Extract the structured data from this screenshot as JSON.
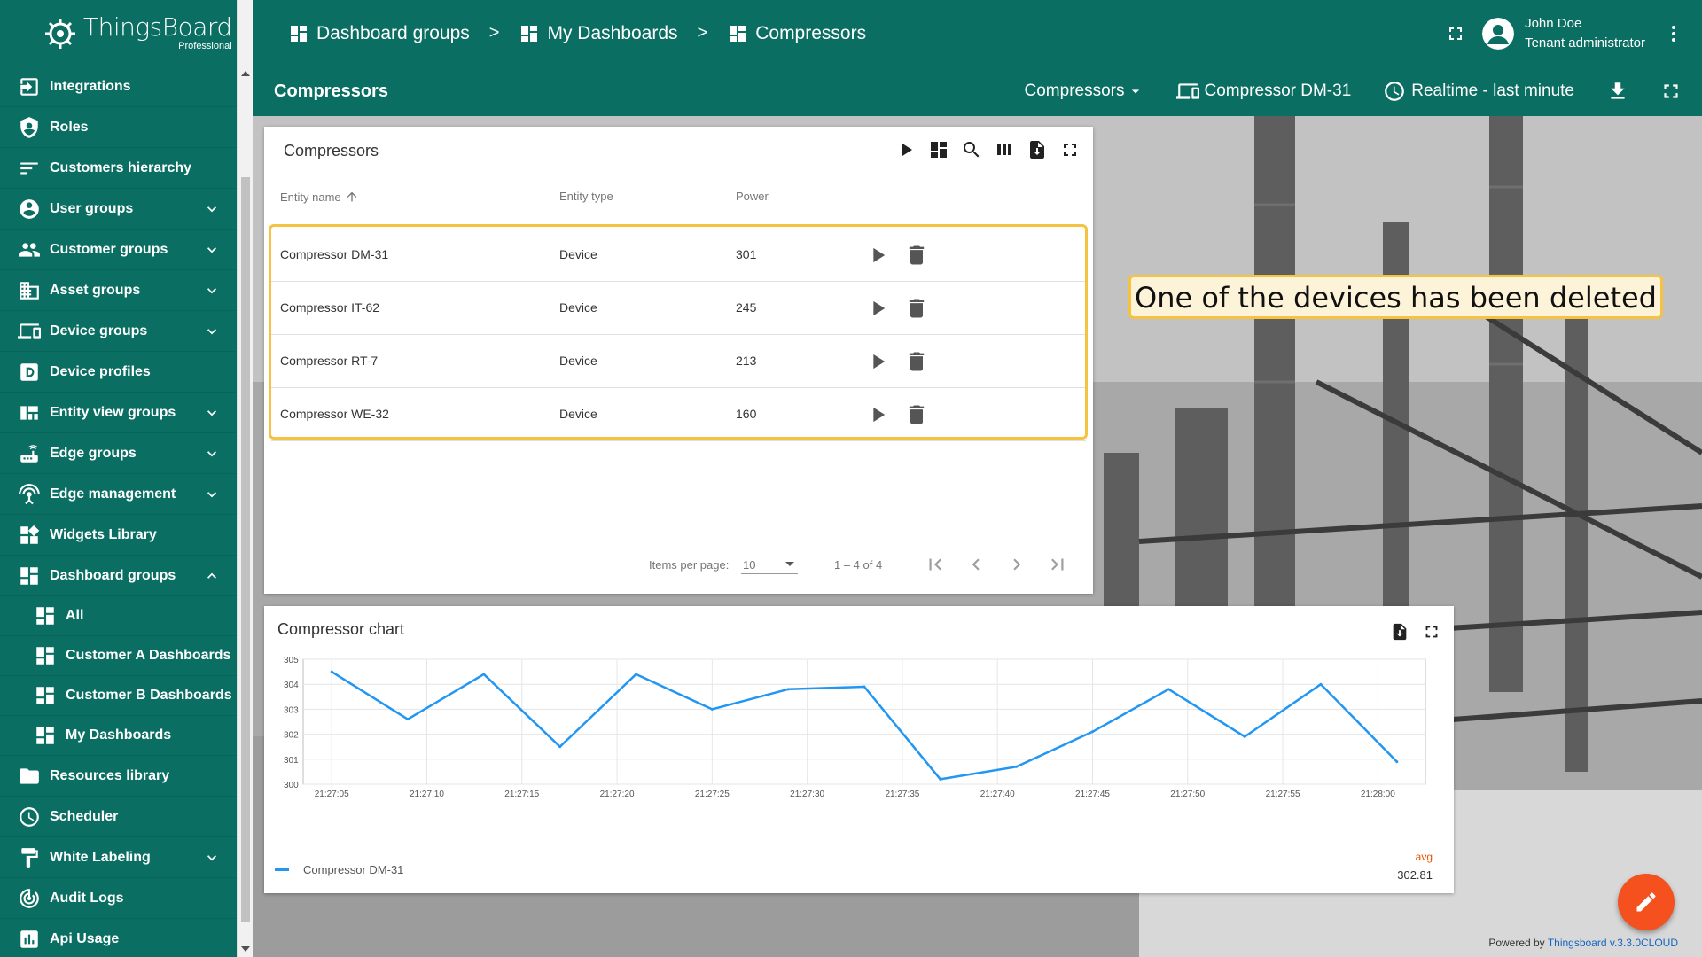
{
  "logo": {
    "name": "ThingsBoard",
    "sub": "Professional"
  },
  "sidebar": {
    "items": [
      {
        "label": "Integrations",
        "icon": "integrations-icon",
        "expandable": false
      },
      {
        "label": "Roles",
        "icon": "shield-icon",
        "expandable": false
      },
      {
        "label": "Customers hierarchy",
        "icon": "hierarchy-icon",
        "expandable": false
      },
      {
        "label": "User groups",
        "icon": "user-icon",
        "expandable": true
      },
      {
        "label": "Customer groups",
        "icon": "people-icon",
        "expandable": true
      },
      {
        "label": "Asset groups",
        "icon": "domain-icon",
        "expandable": true
      },
      {
        "label": "Device groups",
        "icon": "devices-icon",
        "expandable": true
      },
      {
        "label": "Device profiles",
        "icon": "device-profile-icon",
        "expandable": false
      },
      {
        "label": "Entity view groups",
        "icon": "view-quilt-icon",
        "expandable": true
      },
      {
        "label": "Edge groups",
        "icon": "router-icon",
        "expandable": true
      },
      {
        "label": "Edge management",
        "icon": "settings-input-antenna-icon",
        "expandable": true
      },
      {
        "label": "Widgets Library",
        "icon": "widgets-icon",
        "expandable": false
      },
      {
        "label": "Dashboard groups",
        "icon": "dashboard-icon",
        "expandable": true,
        "expanded": true
      },
      {
        "label": "All",
        "icon": "dashboard-icon",
        "sub": true
      },
      {
        "label": "Customer A Dashboards",
        "icon": "dashboard-icon",
        "sub": true
      },
      {
        "label": "Customer B Dashboards",
        "icon": "dashboard-icon",
        "sub": true
      },
      {
        "label": "My Dashboards",
        "icon": "dashboard-icon",
        "sub": true
      },
      {
        "label": "Resources library",
        "icon": "folder-icon",
        "expandable": false
      },
      {
        "label": "Scheduler",
        "icon": "schedule-icon",
        "expandable": false
      },
      {
        "label": "White Labeling",
        "icon": "format-paint-icon",
        "expandable": true
      },
      {
        "label": "Audit Logs",
        "icon": "track-changes-icon",
        "expandable": false
      },
      {
        "label": "Api Usage",
        "icon": "insert-chart-icon",
        "expandable": false
      }
    ]
  },
  "breadcrumbs": [
    "Dashboard groups",
    "My Dashboards",
    "Compressors"
  ],
  "breadcrumb_sep": ">",
  "user": {
    "name": "John Doe",
    "role": "Tenant administrator"
  },
  "dashboard": {
    "title": "Compressors",
    "state_select": "Compressors",
    "entity": "Compressor DM-31",
    "timewindow": "Realtime - last minute"
  },
  "table_widget": {
    "title": "Compressors",
    "columns": [
      "Entity name",
      "Entity type",
      "Power"
    ],
    "rows": [
      {
        "name": "Compressor DM-31",
        "type": "Device",
        "power": "301"
      },
      {
        "name": "Compressor IT-62",
        "type": "Device",
        "power": "245"
      },
      {
        "name": "Compressor RT-7",
        "type": "Device",
        "power": "213"
      },
      {
        "name": "Compressor WE-32",
        "type": "Device",
        "power": "160"
      }
    ],
    "paginator": {
      "label": "Items per page:",
      "page_size": "10",
      "range": "1 – 4 of 4"
    }
  },
  "chart_widget": {
    "title": "Compressor chart",
    "legend_avg_label": "avg",
    "legend_avg_value": "302.81"
  },
  "chart_data": {
    "type": "line",
    "title": "Compressor chart",
    "xlabel": "",
    "ylabel": "",
    "ylim": [
      300,
      305
    ],
    "yticks": [
      "300",
      "301",
      "302",
      "303",
      "304",
      "305"
    ],
    "xticks": [
      "21:27:05",
      "21:27:10",
      "21:27:15",
      "21:27:20",
      "21:27:25",
      "21:27:30",
      "21:27:35",
      "21:27:40",
      "21:27:45",
      "21:27:50",
      "21:27:55",
      "21:28:00"
    ],
    "x": [
      "21:27:05",
      "21:27:09",
      "21:27:13",
      "21:27:17",
      "21:27:21",
      "21:27:25",
      "21:27:29",
      "21:27:33",
      "21:27:37",
      "21:27:41",
      "21:27:45",
      "21:27:49",
      "21:27:53",
      "21:27:57",
      "21:28:01"
    ],
    "series": [
      {
        "name": "Compressor DM-31",
        "color": "#2196f3",
        "values": [
          304.5,
          302.6,
          304.4,
          301.5,
          304.4,
          303.0,
          303.8,
          303.9,
          300.2,
          300.7,
          302.1,
          303.8,
          301.9,
          304.0,
          300.9
        ]
      }
    ],
    "grid": true,
    "legend": "bottom-left"
  },
  "annotation": "One of the devices has been deleted",
  "footer": {
    "prefix": "Powered by",
    "link": "Thingsboard v.3.3.0CLOUD"
  },
  "colors": {
    "primary": "#0a6e62",
    "accent": "#f4511e",
    "highlight": "#f5c242",
    "series": "#2196f3"
  }
}
